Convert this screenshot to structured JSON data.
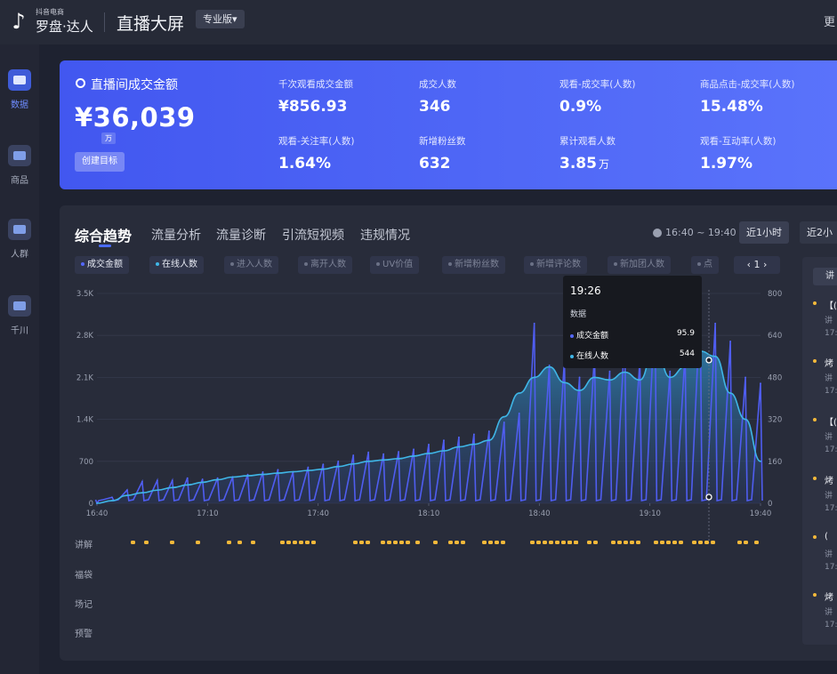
{
  "header": {
    "logo_small": "抖音电商",
    "logo_main": "罗盘·达人",
    "title": "直播大屏",
    "badge": "专业版▾",
    "more": "更"
  },
  "sidebar": {
    "items": [
      {
        "label": "数据",
        "icon": "chart-icon",
        "active": true
      },
      {
        "label": "商品",
        "icon": "cart-icon",
        "active": false
      },
      {
        "label": "人群",
        "icon": "people-icon",
        "active": false
      },
      {
        "label": "千川",
        "icon": "qianchuan-icon",
        "active": false
      }
    ]
  },
  "banner": {
    "gmv_label": "直播间成交金额",
    "gmv_value": "¥36,039",
    "gmv_unit": "万",
    "target_button": "创建目标",
    "metrics": [
      {
        "label": "千次观看成交金额",
        "value": "¥856.93",
        "unit": ""
      },
      {
        "label": "成交人数",
        "value": "346",
        "unit": ""
      },
      {
        "label": "观看-成交率(人数)",
        "value": "0.9%",
        "unit": ""
      },
      {
        "label": "商品点击-成交率(人数)",
        "value": "15.48%",
        "unit": ""
      },
      {
        "label": "观看-关注率(人数)",
        "value": "1.64%",
        "unit": ""
      },
      {
        "label": "新增粉丝数",
        "value": "632",
        "unit": ""
      },
      {
        "label": "累计观看人数",
        "value": "3.85",
        "unit": "万"
      },
      {
        "label": "观看-互动率(人数)",
        "value": "1.97%",
        "unit": ""
      }
    ]
  },
  "panel": {
    "tabs": [
      "综合趋势",
      "流量分析",
      "流量诊断",
      "引流短视频",
      "违规情况"
    ],
    "time_range": "16:40 ~ 19:40",
    "range_buttons": [
      "近1小时",
      "近2小"
    ],
    "chips": [
      "成交金额",
      "在线人数",
      "进入人数",
      "离开人数",
      "UV价值",
      "新增粉丝数",
      "新增评论数",
      "新加团人数",
      "点"
    ],
    "pager": "1",
    "event_rows": [
      "讲解",
      "福袋",
      "场记",
      "预警"
    ]
  },
  "tooltip": {
    "time": "19:26",
    "header": "数据",
    "rows": [
      {
        "label": "成交金额",
        "value": "95.9"
      },
      {
        "label": "在线人数",
        "value": "544"
      }
    ]
  },
  "side_panel": {
    "button": "讲",
    "items": [
      {
        "title": "【(",
        "sub": "讲",
        "time": "17:"
      },
      {
        "title": "烤",
        "sub": "讲",
        "time": "17:"
      },
      {
        "title": "【(",
        "sub": "讲",
        "time": "17:"
      },
      {
        "title": "烤",
        "sub": "讲",
        "time": "17:"
      },
      {
        "title": "(",
        "sub": "讲",
        "time": "17:"
      },
      {
        "title": "烤",
        "sub": "讲",
        "time": "17:"
      }
    ]
  },
  "colors": {
    "accent": "#4a6cff",
    "gmv_series": "#5468ff",
    "online_series": "#3fb6e6",
    "event_dot": "#f5b93a",
    "background": "#1e2230",
    "panel": "#282c3a"
  },
  "chart_data": {
    "type": "line",
    "x": [
      "16:40",
      "17:10",
      "17:40",
      "18:10",
      "18:40",
      "19:10",
      "19:40"
    ],
    "y_left_ticks": [
      "3.5K",
      "2.8K",
      "2.1K",
      "1.4K",
      "700",
      "0"
    ],
    "y_right_ticks": [
      "800",
      "640",
      "480",
      "320",
      "160",
      "0"
    ],
    "ylim_left": [
      0,
      3500
    ],
    "ylim_right": [
      0,
      800
    ],
    "series": [
      {
        "name": "成交金额",
        "axis": "left",
        "values": [
          0,
          100,
          220,
          360,
          380,
          380,
          420,
          400,
          420,
          440,
          480,
          520,
          560,
          520,
          600,
          650,
          700,
          800,
          850,
          820,
          860,
          900,
          980,
          1050,
          1100,
          1150,
          1200,
          1350,
          1500,
          3000,
          2300,
          2400,
          2100,
          2500,
          2200,
          2800,
          2400,
          3300,
          2200,
          2500,
          3300,
          3000,
          2700,
          2100,
          2000
        ]
      },
      {
        "name": "在线人数",
        "axis": "right",
        "values": [
          0,
          10,
          30,
          40,
          50,
          60,
          70,
          80,
          90,
          100,
          105,
          110,
          115,
          120,
          125,
          130,
          140,
          150,
          160,
          165,
          170,
          180,
          190,
          200,
          215,
          225,
          240,
          330,
          420,
          480,
          520,
          460,
          430,
          480,
          470,
          500,
          470,
          600,
          480,
          520,
          580,
          560,
          420,
          320,
          160
        ]
      }
    ]
  }
}
